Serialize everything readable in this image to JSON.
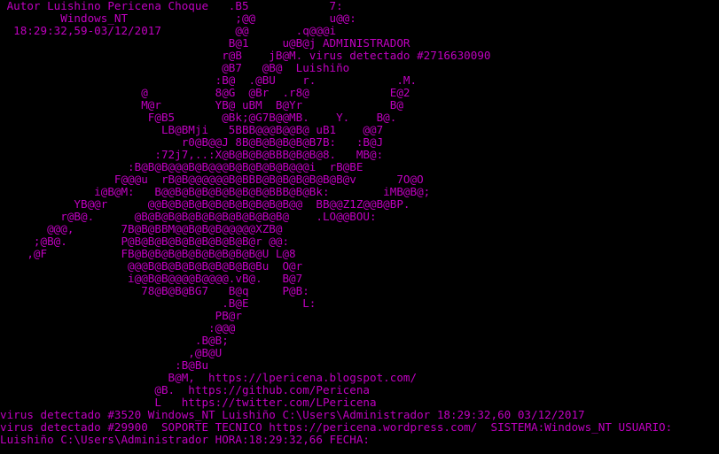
{
  "console": {
    "text_color": "#c000c0",
    "background_color": "#000000",
    "lines": [
      " Autor Luishino Pericena Choque   .B5            7:",
      "         Windows_NT                ;@@           u@@:",
      "  18:29:32,59-03/12/2017           @@       .q@@@i",
      "                                  B@1     u@B@j ADMINISTRADOR",
      "                                 r@B    jB@M. virus detectado #2716630090",
      "                                 @B7   @B@  Luishiño",
      "                                :B@  .@BU    r.            .M.",
      "                     @          8@G  @Br  .r8@            E@2",
      "                     M@r        YB@ uBM  B@Yr             B@",
      "                      F@B5       @Bk;@G7B@@MB.    Y.    B@.",
      "                        LB@BMji   5BBB@@@B@@B@ uB1    @@7",
      "                           r0@B@@J 8B@B@B@B@B@B7B:   :B@J",
      "                       :72j7,..:X@B@B@B@BBB@B@B@8.   MB@:",
      "                   :B@B@B@@@B@B@@@B@B@B@B@B@@@i  rB@BE",
      "                 F@@@u  rB@B@@@@@@B@BBB@B@B@B@B@B@B@v      7O@O",
      "              i@B@M:   B@@B@B@B@B@B@B@B@BBB@B@Bk:        iMB@B@;",
      "           YB@@r      @@B@B@B@B@B@B@B@B@B@B@@  BB@@Z1Z@@B@BP.",
      "         r@B@.      @B@B@B@B@B@B@B@B@B@B@B@    .LO@@BOU:",
      "       @@@,       7B@B@BBM@@B@B@B@@@@@XZB@",
      "     ;@B@.        P@B@B@B@B@B@B@B@B@B@r @@:",
      "    ,@F           FB@B@B@B@B@B@B@B@B@B@U L@8",
      "                   @@@B@B@B@B@B@B@B@B@Bu  O@r",
      "                   i@@B@B@@@@B@@@@.vB@.   B@7",
      "                     78@B@B@BG7   B@q     P@B:",
      "                                 .B@E        L:",
      "                                PB@r",
      "                               :@@@",
      "                             .B@B;",
      "                            ,@B@U",
      "                          :B@Bu",
      "                         B@M,  https://lpericena.blogspot.com/",
      "                       @B.  https://github.com/Pericena",
      "                       L   https://twitter.com/LPericena",
      "virus detectado #3520 Windows_NT Luishiño C:\\Users\\Administrador 18:29:32,60 03/12/2017",
      "virus detectado #29900  SOPORTE TECNICO https://pericena.wordpress.com/  SISTEMA:Windows_NT USUARIO:",
      "Luishiño C:\\Users\\Administrador HORA:18:29:32,66 FECHA:"
    ]
  }
}
